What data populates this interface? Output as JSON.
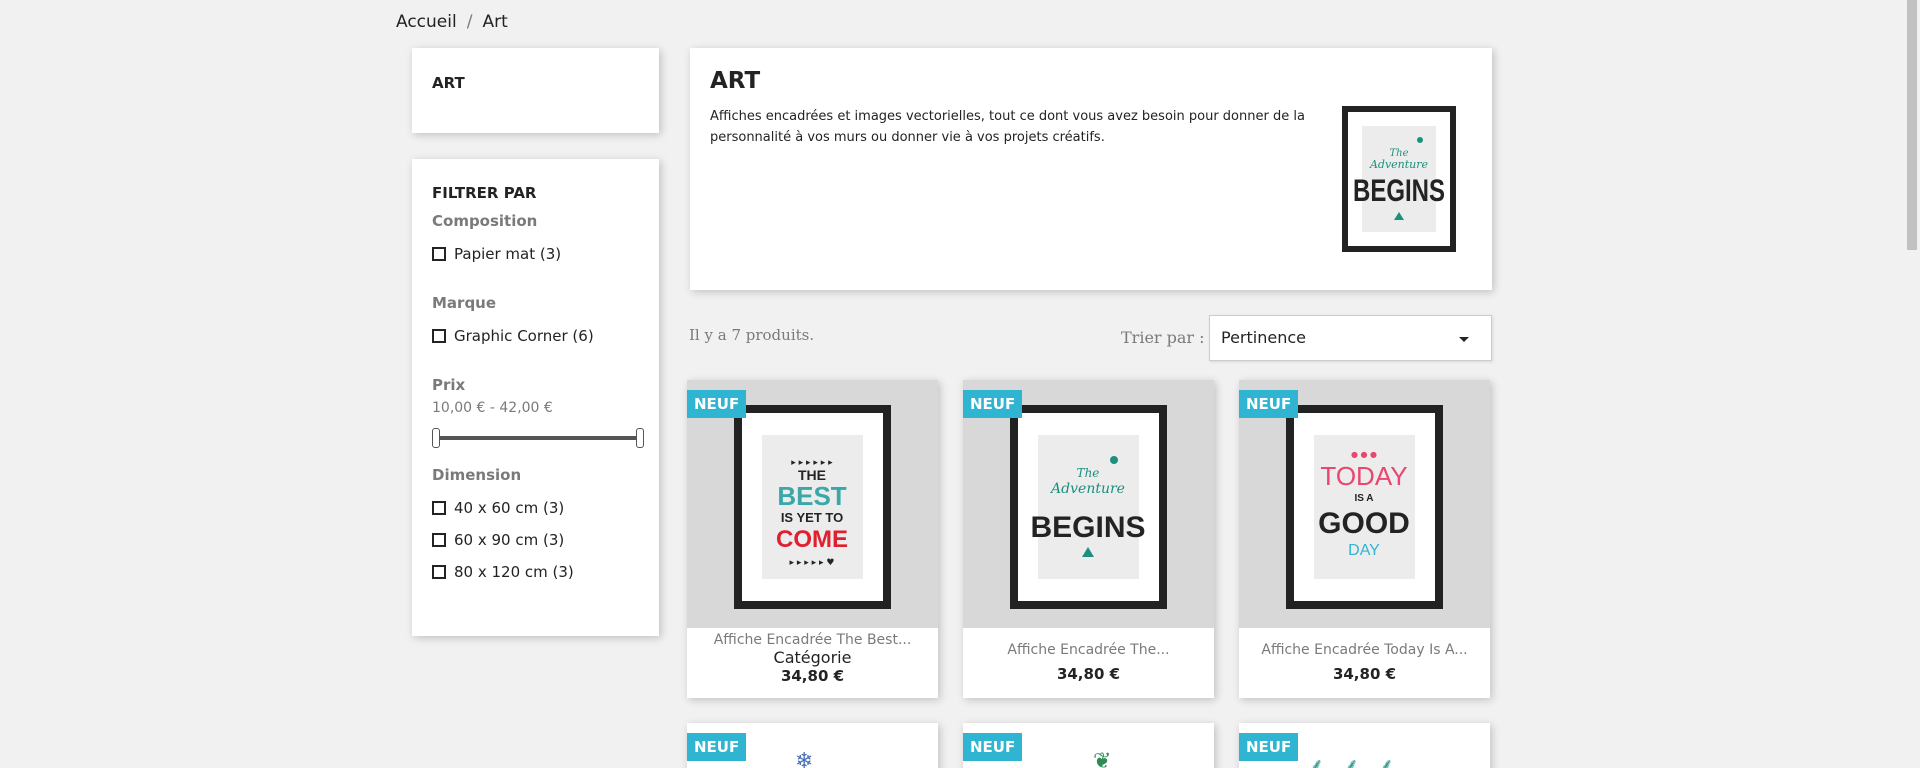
{
  "breadcrumb": {
    "home": "Accueil",
    "separator": "/",
    "current": "Art"
  },
  "category_block": {
    "title": "ART"
  },
  "filters": {
    "title": "FILTRER PAR",
    "composition": {
      "title": "Composition",
      "items": [
        "Papier mat (3)"
      ]
    },
    "brand": {
      "title": "Marque",
      "items": [
        "Graphic Corner (6)"
      ]
    },
    "price": {
      "title": "Prix",
      "range": "10,00 € - 42,00 €"
    },
    "dimension": {
      "title": "Dimension",
      "items": [
        "40 x 60 cm (3)",
        "60 x 90 cm (3)",
        "80 x 120 cm (3)"
      ]
    }
  },
  "hero": {
    "title": "ART",
    "description": "Affiches encadrées et images vectorielles, tout ce dont vous avez besoin pour donner de la personnalité à vos murs ou donner vie à vos projets créatifs."
  },
  "listing": {
    "count_text": "Il y a 7 produits.",
    "sort_label": "Trier par :",
    "sort_value": "Pertinence"
  },
  "products": [
    {
      "badge": "NEUF",
      "name": "Affiche Encadrée The Best...",
      "subcat": "Catégorie",
      "price": "34,80 €",
      "art": [
        "THE",
        "BEST",
        "IS YET TO",
        "COME"
      ]
    },
    {
      "badge": "NEUF",
      "name": "Affiche Encadrée The...",
      "price": "34,80 €",
      "art": [
        "The",
        "Adventure",
        "BEGINS"
      ]
    },
    {
      "badge": "NEUF",
      "name": "Affiche Encadrée Today Is A...",
      "price": "34,80 €",
      "art": [
        "TODAY",
        "IS A",
        "GOOD",
        "DAY"
      ]
    }
  ],
  "products_row2": [
    {
      "badge": "NEUF"
    },
    {
      "badge": "NEUF"
    },
    {
      "badge": "NEUF"
    }
  ],
  "hero_art": [
    "The",
    "Adventure",
    "BEGINS"
  ],
  "colors": {
    "accent": "#2fb5d2",
    "teal": "#1c8f7e",
    "red": "#e0202f",
    "pink": "#e8476f"
  }
}
